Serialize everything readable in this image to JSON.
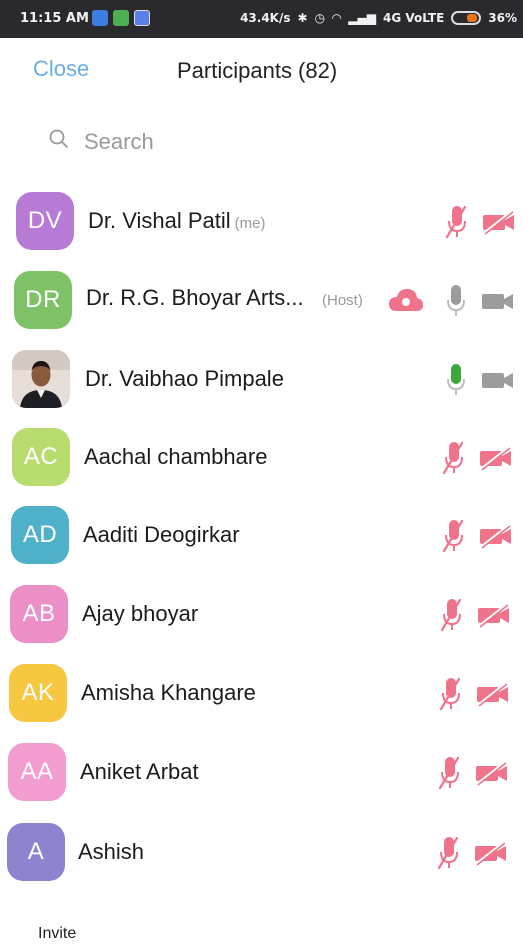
{
  "status_bar": {
    "time": "11:15 AM",
    "speed": "43.4K/s",
    "network": "4G VoLTE",
    "battery": "36%"
  },
  "header": {
    "close_label": "Close",
    "title": "Participants (82)"
  },
  "search": {
    "placeholder": "Search"
  },
  "participants": [
    {
      "initials": "DV",
      "name": "Dr. Vishal Patil",
      "tag": "(me)",
      "avatar_color": "#b77bd6",
      "mic": "muted",
      "video": "off"
    },
    {
      "initials": "DR",
      "name": "Dr. R.G. Bhoyar Arts...",
      "tag": "(Host)",
      "avatar_color": "#7fc167",
      "mic": "on-idle",
      "video": "off-gray",
      "cloud_recording": true
    },
    {
      "initials": "",
      "name": "Dr. Vaibhao Pimpale",
      "tag": "",
      "avatar_color": "#9b8b80",
      "mic": "speaking",
      "video": "off-gray",
      "photo": true
    },
    {
      "initials": "AC",
      "name": "Aachal chambhare",
      "tag": "",
      "avatar_color": "#b8dc6e",
      "mic": "muted",
      "video": "off"
    },
    {
      "initials": "AD",
      "name": "Aaditi Deogirkar",
      "tag": "",
      "avatar_color": "#4fb0c9",
      "mic": "muted",
      "video": "off"
    },
    {
      "initials": "AB",
      "name": "Ajay bhoyar",
      "tag": "",
      "avatar_color": "#eb8fc6",
      "mic": "muted",
      "video": "off"
    },
    {
      "initials": "AK",
      "name": "Amisha Khangare",
      "tag": "",
      "avatar_color": "#f6c741",
      "mic": "muted",
      "video": "off"
    },
    {
      "initials": "AA",
      "name": "Aniket Arbat",
      "tag": "",
      "avatar_color": "#f29ccf",
      "mic": "muted",
      "video": "off"
    },
    {
      "initials": "A",
      "name": "Ashish",
      "tag": "",
      "avatar_color": "#8d84d0",
      "mic": "muted",
      "video": "off"
    }
  ],
  "footer": {
    "invite_label": "Invite"
  },
  "colors": {
    "accent": "#6aaee8",
    "muted_red": "#f0738c",
    "speaking_green": "#3aa83a",
    "inactive_gray": "#9c9c9c"
  }
}
